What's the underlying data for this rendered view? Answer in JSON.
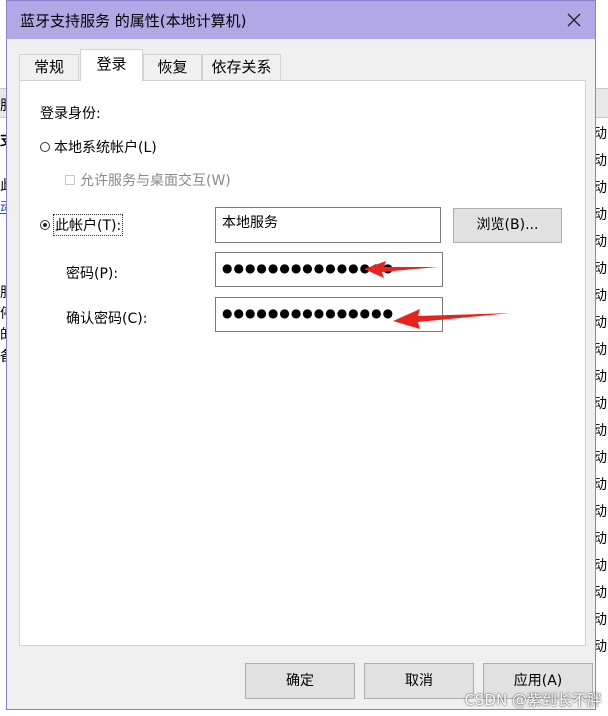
{
  "window": {
    "title": "蓝牙支持服务 的属性(本地计算机)"
  },
  "tabs": [
    {
      "label": "常规",
      "active": false
    },
    {
      "label": "登录",
      "active": true
    },
    {
      "label": "恢复",
      "active": false
    },
    {
      "label": "依存关系",
      "active": false
    }
  ],
  "logon": {
    "heading": "登录身份:",
    "local_system_label": "本地系统帐户(L)",
    "allow_desktop_label": "允许服务与桌面交互(W)",
    "this_account_label": "此帐户(T):",
    "this_account_value": "本地服务",
    "browse_label": "浏览(B)...",
    "password_label": "密码(P):",
    "password_value": "●●●●●●●●●●●●●●●",
    "confirm_label": "确认密码(C):",
    "confirm_value": "●●●●●●●●●●●●●●●",
    "selected": "this_account"
  },
  "footer": {
    "ok_label": "确定",
    "cancel_label": "取消",
    "apply_label": "应用(A)"
  },
  "background": {
    "left_chars": [
      "服",
      "支",
      "此",
      "动",
      "服",
      "停",
      "的",
      "备"
    ],
    "right_chars": [
      "动",
      "动",
      "动",
      "动",
      "动",
      "动",
      "动",
      "动",
      "动",
      "动",
      "动",
      "动",
      "动",
      "动",
      "动",
      "动",
      "动",
      "动",
      "动",
      "动"
    ]
  },
  "annotation_color": "#e8231e",
  "watermark": "CSDN @紫到长不胖"
}
